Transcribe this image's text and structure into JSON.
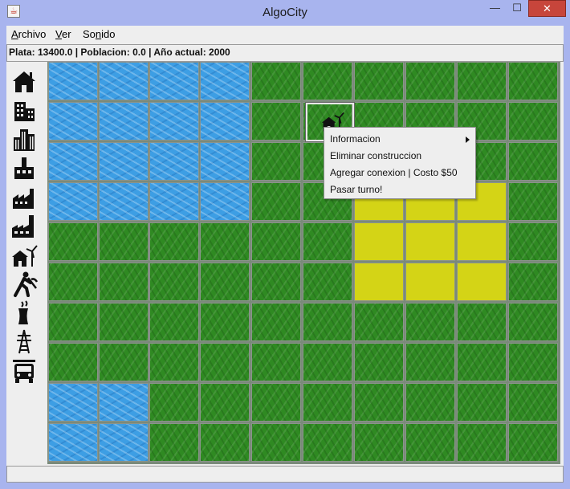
{
  "window": {
    "title": "AlgoCity",
    "minimize_label": "—",
    "maximize_label": "☐",
    "close_label": "✕"
  },
  "menu": {
    "items": [
      {
        "label": "Archivo",
        "mnemonic": "A",
        "rest": "rchivo"
      },
      {
        "label": "Ver",
        "mnemonic": "V",
        "rest": "er"
      },
      {
        "label": "Sonido",
        "pre": "So",
        "mnemonic": "n",
        "rest": "ido"
      }
    ]
  },
  "status": {
    "text": "Plata: 13400.0 | Poblacion: 0.0 | Año actual: 2000"
  },
  "toolbar": {
    "tools": [
      {
        "name": "house-icon"
      },
      {
        "name": "commercial-building-icon"
      },
      {
        "name": "skyscrapers-icon"
      },
      {
        "name": "factory-small-icon"
      },
      {
        "name": "factory-medium-icon"
      },
      {
        "name": "factory-large-icon"
      },
      {
        "name": "wind-power-house-icon"
      },
      {
        "name": "worker-pickaxe-icon"
      },
      {
        "name": "nuclear-plant-icon"
      },
      {
        "name": "power-tower-icon"
      },
      {
        "name": "fire-truck-icon"
      }
    ]
  },
  "map": {
    "rows": [
      [
        "water",
        "water",
        "water",
        "water",
        "grass",
        "grass",
        "grass",
        "grass",
        "grass",
        "grass"
      ],
      [
        "water",
        "water",
        "water",
        "water",
        "grass",
        "grass",
        "grass",
        "grass",
        "grass",
        "grass"
      ],
      [
        "water",
        "water",
        "water",
        "water",
        "grass",
        "grass",
        "grass",
        "grass",
        "grass",
        "grass"
      ],
      [
        "water",
        "water",
        "water",
        "water",
        "grass",
        "grass",
        "zone",
        "zone",
        "zone",
        "grass"
      ],
      [
        "grass",
        "grass",
        "grass",
        "grass",
        "grass",
        "grass",
        "zone",
        "zone",
        "zone",
        "grass"
      ],
      [
        "grass",
        "grass",
        "grass",
        "grass",
        "grass",
        "grass",
        "zone",
        "zone",
        "zone",
        "grass"
      ],
      [
        "grass",
        "grass",
        "grass",
        "grass",
        "grass",
        "grass",
        "grass",
        "grass",
        "grass",
        "grass"
      ],
      [
        "grass",
        "grass",
        "grass",
        "grass",
        "grass",
        "grass",
        "grass",
        "grass",
        "grass",
        "grass"
      ],
      [
        "water",
        "water",
        "grass",
        "grass",
        "grass",
        "grass",
        "grass",
        "grass",
        "grass",
        "grass"
      ],
      [
        "water",
        "water",
        "grass",
        "grass",
        "grass",
        "grass",
        "grass",
        "grass",
        "grass",
        "grass"
      ]
    ],
    "colors": {
      "grass": "#2f8a22",
      "water": "#3d9ee4",
      "zone": "#d4d416"
    }
  },
  "context_menu": {
    "items": [
      {
        "label": "Informacion",
        "submenu": true
      },
      {
        "label": "Eliminar construccion"
      },
      {
        "label": "Agregar conexion | Costo $50"
      },
      {
        "label": "Pasar turno!"
      }
    ]
  }
}
